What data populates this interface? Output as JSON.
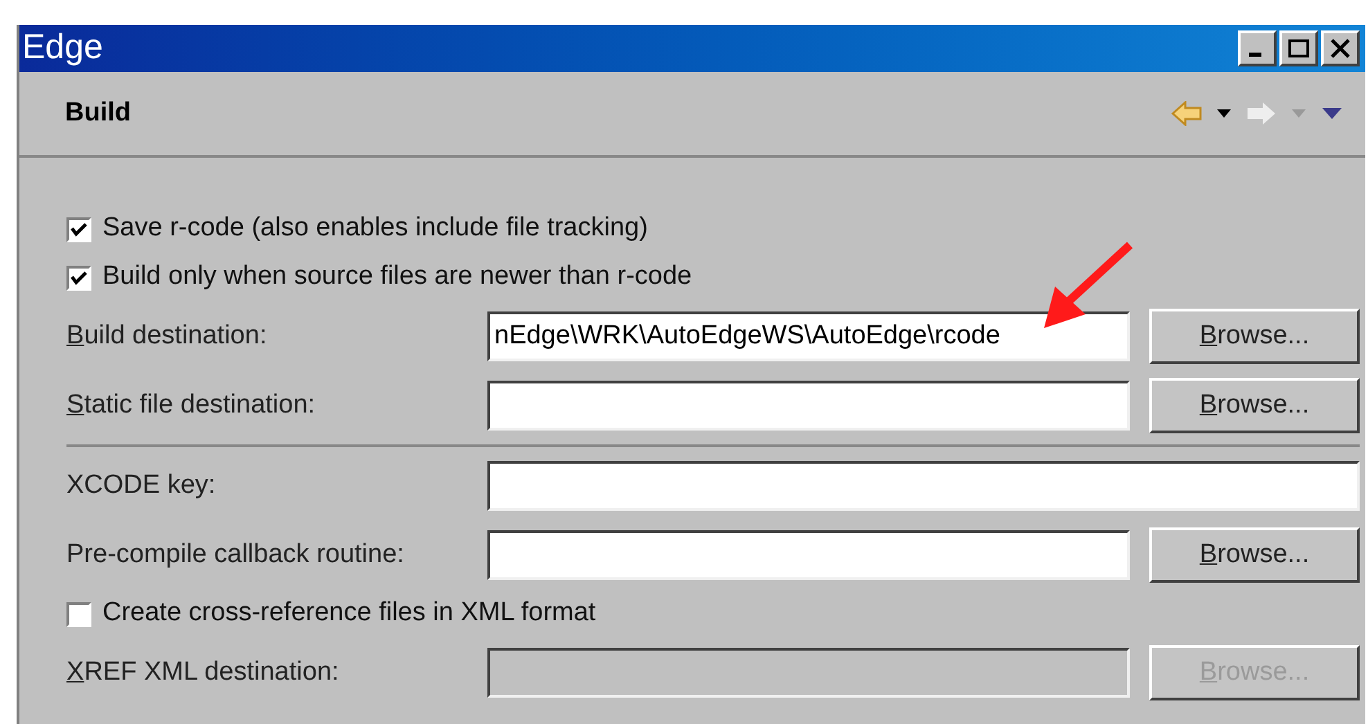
{
  "window": {
    "title": "Edge"
  },
  "header": {
    "title": "Build"
  },
  "rows": [
    {
      "kind": "checkbox",
      "label": "Save r-code (also enables include file tracking)",
      "checked": true
    },
    {
      "kind": "checkbox",
      "label": "Build only when source files are newer than r-code",
      "checked": true
    },
    {
      "kind": "field",
      "label": "Build destination:",
      "mnemonic": true,
      "value": "nEdge\\WRK\\AutoEdgeWS\\AutoEdge\\rcode",
      "disabled": false,
      "button": "Browse...",
      "pointer": true
    },
    {
      "kind": "field",
      "label": "Static file destination:",
      "mnemonic": true,
      "disabled": false,
      "button": "Browse..."
    },
    {
      "kind": "separator"
    },
    {
      "kind": "field",
      "label": "XCODE key:",
      "mnemonic": false,
      "disabled": false
    },
    {
      "kind": "field",
      "label": "Pre-compile callback routine:",
      "mnemonic": false,
      "disabled": false,
      "button": "Browse..."
    },
    {
      "kind": "checkbox",
      "label": "Create cross-reference files in XML format",
      "checked": false
    },
    {
      "kind": "field",
      "label": "XREF XML destination:",
      "mnemonic": true,
      "disabled": true,
      "button": "Browse..."
    }
  ]
}
